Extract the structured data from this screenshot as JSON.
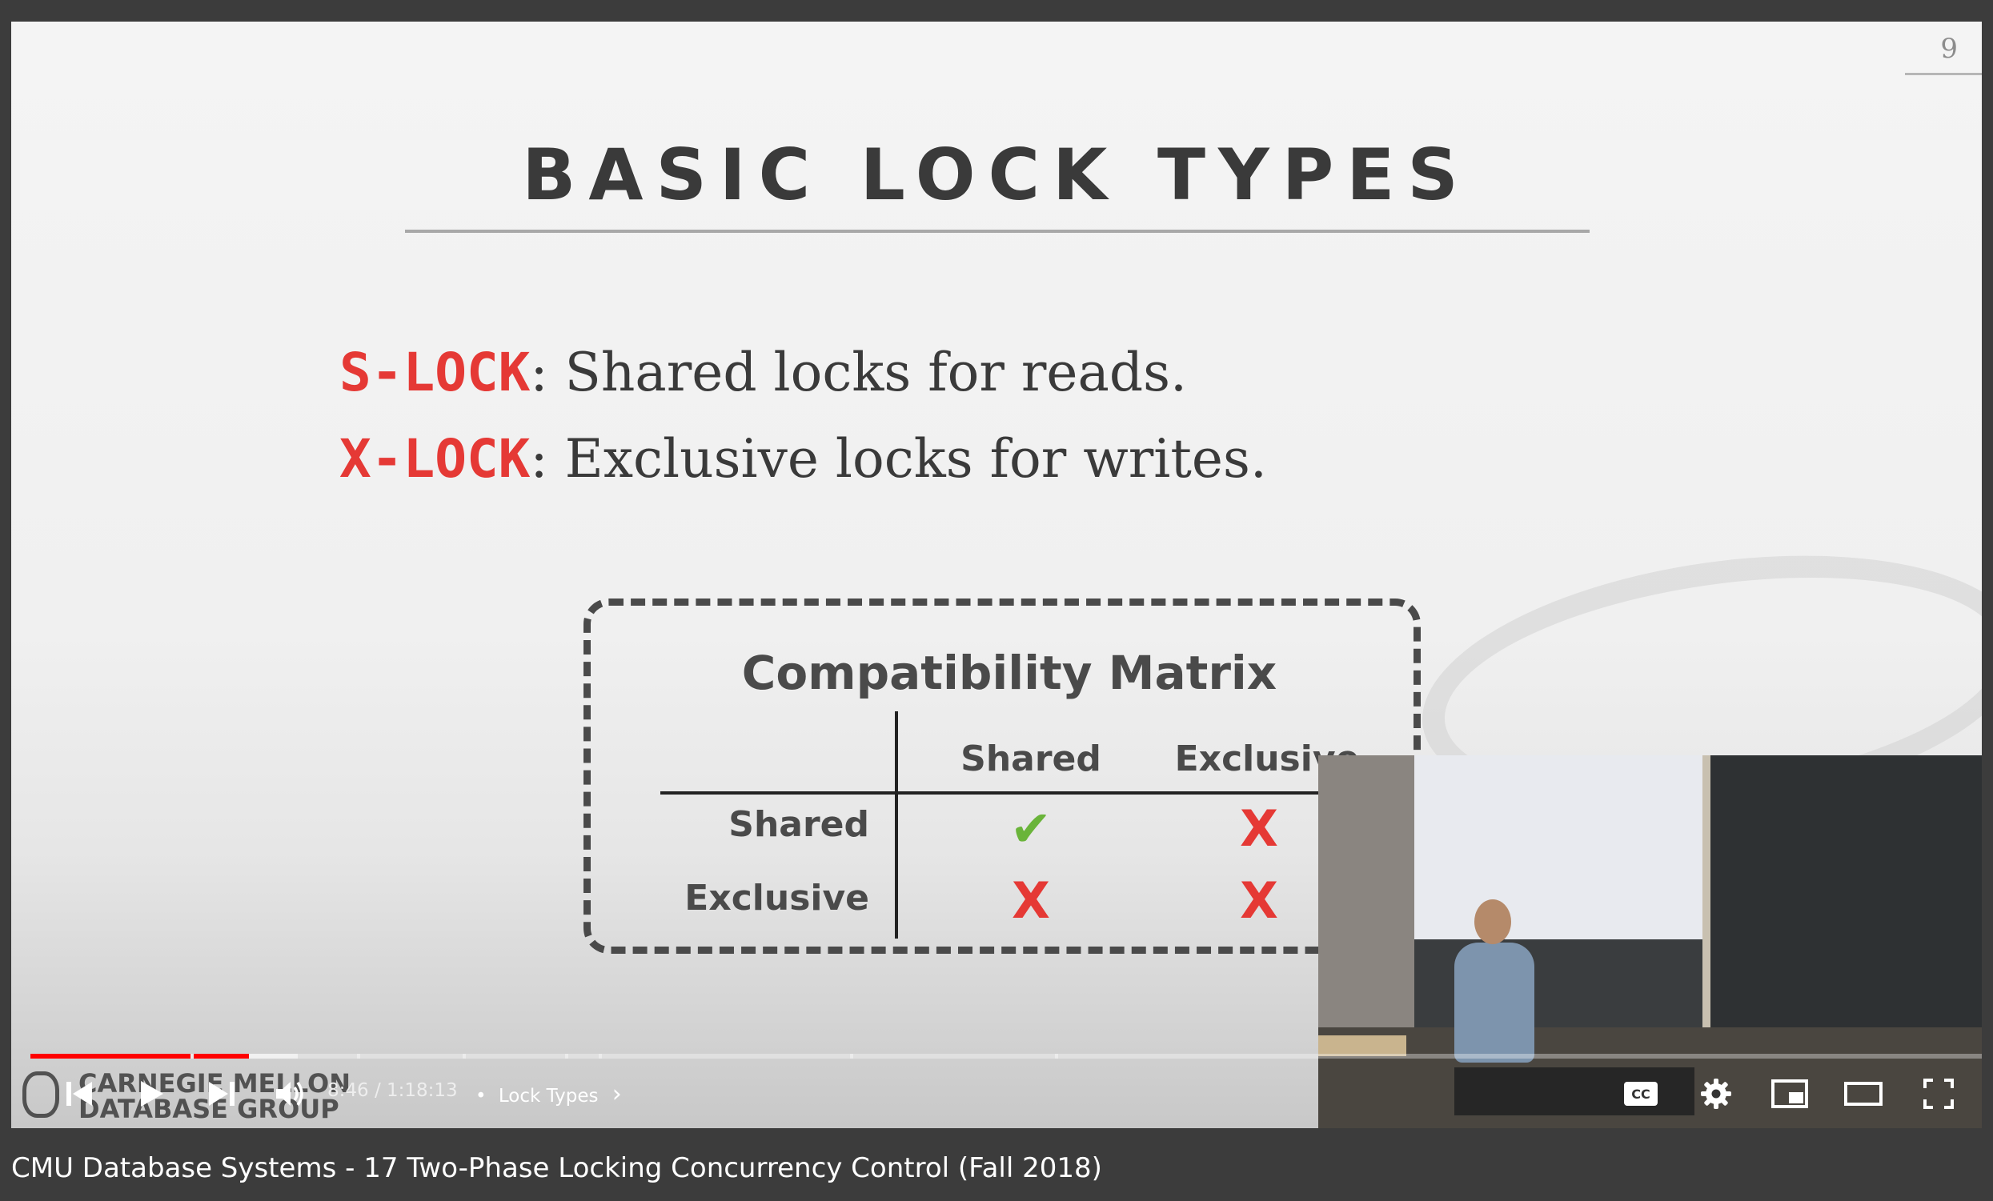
{
  "slide": {
    "page_number": "9",
    "title": "BASIC LOCK TYPES",
    "lines": [
      {
        "tag": "S-LOCK",
        "text": ": Shared locks for reads."
      },
      {
        "tag": "X-LOCK",
        "text": ": Exclusive locks for writes."
      }
    ],
    "matrix": {
      "title": "Compatibility Matrix",
      "col_headers": [
        "Shared",
        "Exclusive"
      ],
      "row_headers": [
        "Shared",
        "Exclusive"
      ],
      "cells": [
        [
          "✔",
          "X"
        ],
        [
          "X",
          "X"
        ]
      ]
    },
    "watermark": [
      "CARNEGIE MELLON",
      "DATABASE GROUP"
    ]
  },
  "player": {
    "time": "8:46 / 1:18:13",
    "separator": "•",
    "chapter": "Lock Types",
    "chapter_chevron": "›",
    "progress_fraction": 0.112,
    "buffered_fraction": 0.137,
    "colors": {
      "played": "#ff0000",
      "accent": "#e53935",
      "check": "#6ab43a"
    }
  },
  "icons": [
    "previous-icon",
    "play-icon",
    "next-icon",
    "volume-icon",
    "cc-icon",
    "settings-icon",
    "miniplayer-icon",
    "theater-icon",
    "fullscreen-icon"
  ],
  "video_title": "CMU Database Systems - 17 Two-Phase Locking Concurrency Control (Fall 2018)"
}
